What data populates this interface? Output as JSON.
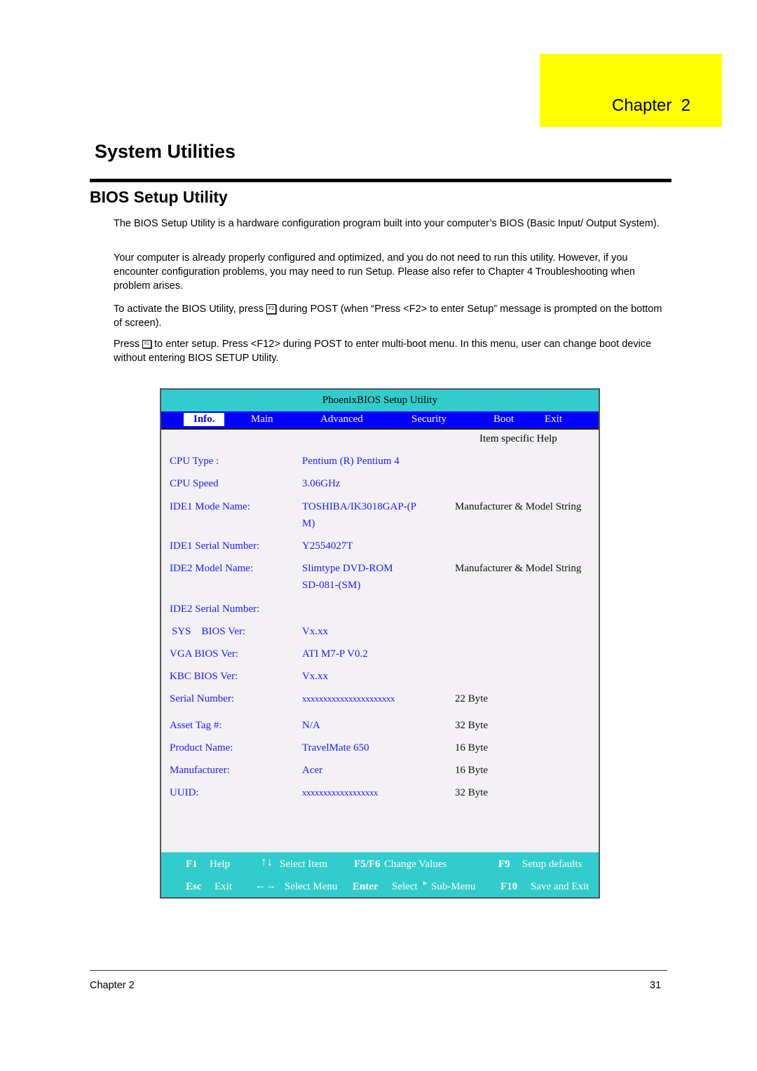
{
  "chapter_tab": {
    "label": "Chapter  2",
    "color": "#ffff00"
  },
  "page_title": "System Utilities",
  "section_title": "BIOS Setup Utility",
  "paragraphs": {
    "p1": "The BIOS Setup Utility is a hardware configuration program built into your computer’s BIOS (Basic Input/ Output System).",
    "p2": "Your computer is already properly configured and optimized, and you do not need to run this utility. However, if you encounter configuration problems, you may need to run Setup.  Please also refer to Chapter 4 Troubleshooting when problem arises.",
    "p3_before": "To activate the BIOS Utility, press",
    "p3_after": "during POST (when “Press <F2> to enter Setup” message is prompted on the bottom of screen).",
    "p4_before": "Press",
    "p4_after": "to enter setup. Press <F12> during POST to enter multi-boot menu. In this menu, user can change boot device without entering BIOS SETUP Utility.",
    "key_icon_label": "F2"
  },
  "bios": {
    "title": "PhoenixBIOS Setup Utility",
    "tabs": [
      "Info.",
      "Main",
      "Advanced",
      "Security",
      "Boot",
      "Exit"
    ],
    "active_tab": "Info.",
    "help_header": "Item specific Help",
    "rows": [
      {
        "label": "CPU Type :",
        "value": "Pentium (R) Pentium 4",
        "help": ""
      },
      {
        "label": "CPU Speed",
        "value": "3.06GHz",
        "help": ""
      },
      {
        "label": "IDE1 Mode Name:",
        "value": "TOSHIBA/IK3018GAP-(P",
        "value2": "M)",
        "help": "Manufacturer & Model String"
      },
      {
        "label": "IDE1 Serial Number:",
        "value": "Y2554027T",
        "help": ""
      },
      {
        "label": "IDE2 Model Name:",
        "value": "Slimtype DVD-ROM",
        "value2": "SD-081-(SM)",
        "help": "Manufacturer & Model String"
      },
      {
        "label": "IDE2 Serial Number:",
        "value": "",
        "help": ""
      },
      {
        "label": "SYS    BIOS Ver:",
        "value": "Vx.xx",
        "help": ""
      },
      {
        "label": "VGA BIOS Ver:",
        "value": "ATI M7-P V0.2",
        "help": ""
      },
      {
        "label": "KBC BIOS Ver:",
        "value": "Vx.xx",
        "help": ""
      },
      {
        "label": "Serial Number:",
        "value": "xxxxxxxxxxxxxxxxxxxxxx",
        "help": "22 Byte"
      },
      {
        "label": "Asset Tag #:",
        "value": "N/A",
        "help": "32 Byte"
      },
      {
        "label": "Product Name:",
        "value": "TravelMate 650",
        "help": "16 Byte"
      },
      {
        "label": "Manufacturer:",
        "value": "Acer",
        "help": "16 Byte"
      },
      {
        "label": "UUID:",
        "value": "xxxxxxxxxxxxxxxxxx",
        "help": "32 Byte"
      }
    ],
    "footer": {
      "f1_key": "F1",
      "f1_desc": "Help",
      "updown_icon": "↑↓",
      "updown_desc": "Select Item",
      "f5f6_key": "F5/F6",
      "f5f6_desc": "Change Values",
      "f9_key": "F9",
      "f9_desc": "Setup defaults",
      "esc_key": "Esc",
      "esc_desc": "Exit",
      "leftright_icon": "←→",
      "leftright_desc": "Select Menu",
      "enter_key": "Enter",
      "enter_desc": "Select",
      "submenu_icon": "▸",
      "submenu_desc": "Sub-Menu",
      "f10_key": "F10",
      "f10_desc": "Save and Exit"
    },
    "colors": {
      "title_bar": "#33cccc",
      "menu_bar": "#0000ff",
      "label_text": "#1a1aff",
      "body_bg": "#f3f1f4"
    }
  },
  "page_footer": {
    "left": "Chapter 2",
    "page_number": "31"
  }
}
